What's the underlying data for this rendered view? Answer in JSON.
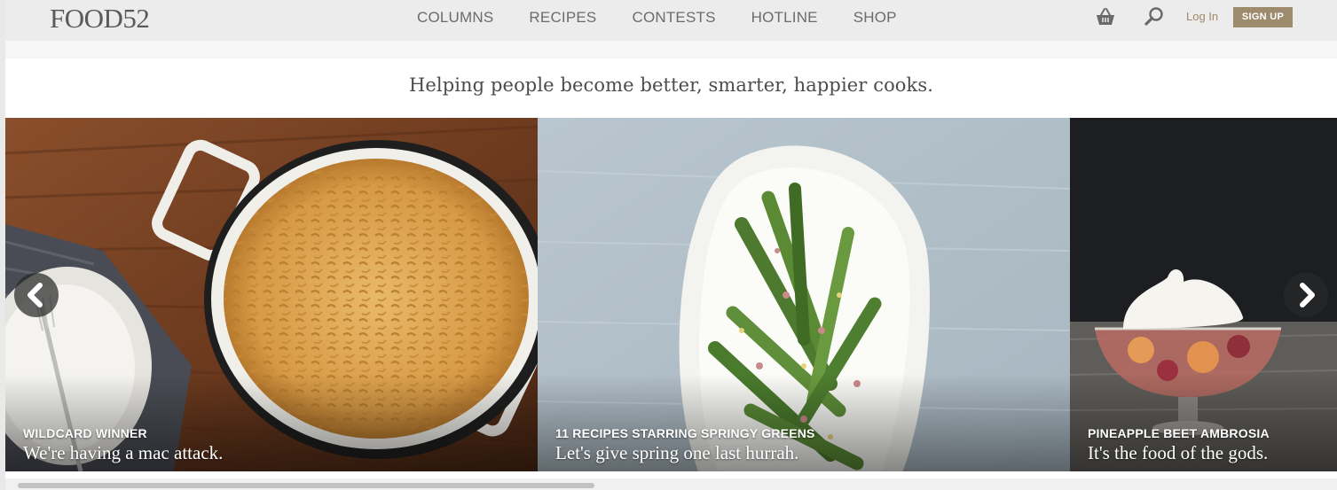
{
  "header": {
    "logo": "FOOD52",
    "nav": [
      "COLUMNS",
      "RECIPES",
      "CONTESTS",
      "HOTLINE",
      "SHOP"
    ],
    "basket_icon": "basket-icon",
    "search_icon": "search-icon",
    "login_label": "Log In",
    "signup_label": "SIGN UP"
  },
  "tagline": "Helping people become better, smarter, happier cooks.",
  "carousel": {
    "slides": [
      {
        "kicker": "WILDCARD WINNER",
        "caption": "We're having a mac attack."
      },
      {
        "kicker": "11 RECIPES STARRING SPRINGY GREENS",
        "caption": "Let's give spring one last hurrah."
      },
      {
        "kicker": "PINEAPPLE BEET AMBROSIA",
        "caption": "It's the food of the gods."
      }
    ],
    "prev_icon": "chevron-left-icon",
    "next_icon": "chevron-right-icon"
  },
  "colors": {
    "brand_accent": "#9e8a6c",
    "header_bg": "#ececec",
    "nav_text": "#6b6b6b"
  }
}
